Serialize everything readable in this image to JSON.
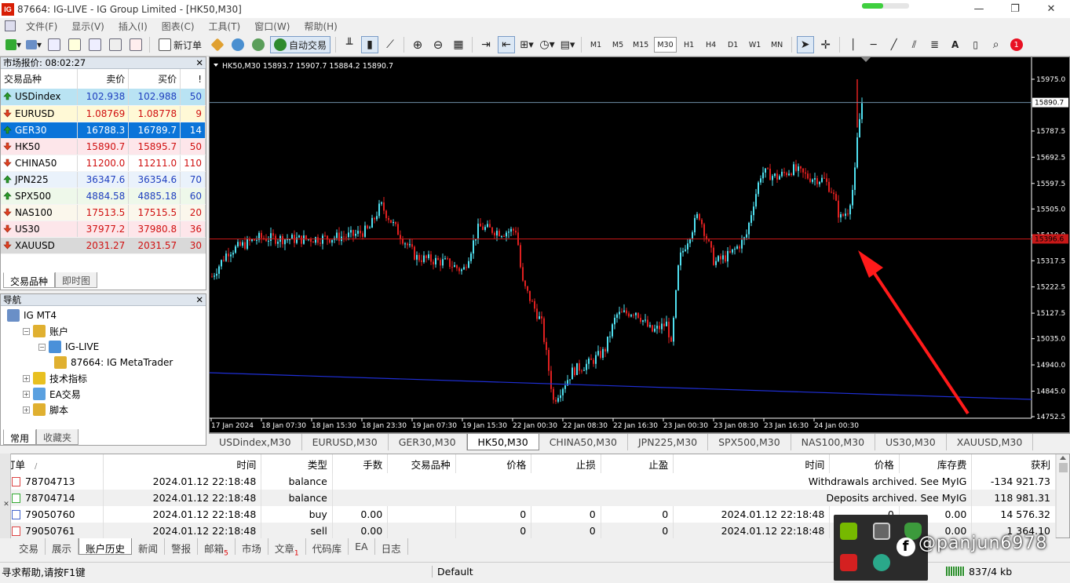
{
  "window": {
    "title": "87664: IG-LIVE - IG Group Limited - [HK50,M30]",
    "logo": "IG"
  },
  "menu": [
    "文件(F)",
    "显示(V)",
    "插入(I)",
    "图表(C)",
    "工具(T)",
    "窗口(W)",
    "帮助(H)"
  ],
  "toolbar": {
    "new_order": "新订单",
    "auto_trade": "自动交易",
    "notification_count": "1",
    "timeframes": [
      "M1",
      "M5",
      "M15",
      "M30",
      "H1",
      "H4",
      "D1",
      "W1",
      "MN"
    ],
    "active_timeframe": "M30"
  },
  "market_watch": {
    "title": "市场报价: 08:02:27",
    "headers": [
      "交易品种",
      "卖价",
      "买价",
      "!"
    ],
    "rows": [
      {
        "symbol": "USDindex",
        "bid": "102.938",
        "ask": "102.988",
        "spread": "50",
        "dir": "up",
        "bg": "#b9e3f3",
        "color": "#1f3fbf"
      },
      {
        "symbol": "EURUSD",
        "bid": "1.08769",
        "ask": "1.08778",
        "spread": "9",
        "dir": "down",
        "bg": "#fff9d6",
        "color": "#d01010"
      },
      {
        "symbol": "GER30",
        "bid": "16788.3",
        "ask": "16789.7",
        "spread": "14",
        "dir": "up",
        "bg": "#0a74d9",
        "color": "#ffffff"
      },
      {
        "symbol": "HK50",
        "bid": "15890.7",
        "ask": "15895.7",
        "spread": "50",
        "dir": "down",
        "bg": "#fde6ea",
        "color": "#d01010"
      },
      {
        "symbol": "CHINA50",
        "bid": "11200.0",
        "ask": "11211.0",
        "spread": "110",
        "dir": "down",
        "bg": "#ffffff",
        "color": "#d01010"
      },
      {
        "symbol": "JPN225",
        "bid": "36347.6",
        "ask": "36354.6",
        "spread": "70",
        "dir": "up",
        "bg": "#eaf2fb",
        "color": "#1f3fbf"
      },
      {
        "symbol": "SPX500",
        "bid": "4884.58",
        "ask": "4885.18",
        "spread": "60",
        "dir": "up",
        "bg": "#eef8ea",
        "color": "#1f3fbf"
      },
      {
        "symbol": "NAS100",
        "bid": "17513.5",
        "ask": "17515.5",
        "spread": "20",
        "dir": "down",
        "bg": "#fbf7ec",
        "color": "#d01010"
      },
      {
        "symbol": "US30",
        "bid": "37977.2",
        "ask": "37980.8",
        "spread": "36",
        "dir": "down",
        "bg": "#fde6ea",
        "color": "#d01010"
      },
      {
        "symbol": "XAUUSD",
        "bid": "2031.27",
        "ask": "2031.57",
        "spread": "30",
        "dir": "down",
        "bg": "#d9d9d9",
        "color": "#d01010"
      }
    ],
    "tabs": [
      "交易品种",
      "即时图"
    ]
  },
  "navigator": {
    "title": "导航",
    "items": [
      {
        "label": "IG MT4",
        "level": 0,
        "exp": "",
        "icon": "#6a8fc7"
      },
      {
        "label": "账户",
        "level": 1,
        "exp": "−",
        "icon": "#e0b030"
      },
      {
        "label": "IG-LIVE",
        "level": 2,
        "exp": "−",
        "icon": "#4a90d9"
      },
      {
        "label": "87664: IG MetaTrader",
        "level": 3,
        "exp": "",
        "icon": "#e0b030"
      },
      {
        "label": "技术指标",
        "level": 1,
        "exp": "+",
        "icon": "#e8c020"
      },
      {
        "label": "EA交易",
        "level": 1,
        "exp": "+",
        "icon": "#5aa0e0"
      },
      {
        "label": "脚本",
        "level": 1,
        "exp": "+",
        "icon": "#e0b030"
      }
    ],
    "tabs": [
      "常用",
      "收藏夹"
    ]
  },
  "chart": {
    "header": "HK50,M30  15893.7 15907.7 15884.2 15890.7",
    "current_price": "15890.7",
    "hline_label": "15396.6",
    "ticks": [
      "15975.0",
      "15787.5",
      "15692.5",
      "15597.5",
      "15505.0",
      "15410.0",
      "15317.5",
      "15222.5",
      "15127.5",
      "15035.0",
      "14940.0",
      "14845.0",
      "14752.5"
    ],
    "time_labels": [
      "17 Jan 2024",
      "18 Jan 07:30",
      "18 Jan 15:30",
      "18 Jan 23:30",
      "19 Jan 07:30",
      "19 Jan 15:30",
      "22 Jan 00:30",
      "22 Jan 08:30",
      "22 Jan 16:30",
      "23 Jan 00:30",
      "23 Jan 08:30",
      "23 Jan 16:30",
      "24 Jan 00:30"
    ],
    "bull_color": "#50e0f0",
    "bear_color": "#e02020",
    "grid": false
  },
  "chart_tabs": [
    "USDindex,M30",
    "EURUSD,M30",
    "GER30,M30",
    "HK50,M30",
    "CHINA50,M30",
    "JPN225,M30",
    "SPX500,M30",
    "NAS100,M30",
    "US30,M30",
    "XAUUSD,M30"
  ],
  "active_chart_tab": "HK50,M30",
  "terminal": {
    "headers": [
      "订单",
      "时间",
      "类型",
      "手数",
      "交易品种",
      "价格",
      "止损",
      "止盈",
      "时间",
      "价格",
      "库存费",
      "获利"
    ],
    "rows": [
      {
        "order": "78704713",
        "time": "2024.01.12 22:18:48",
        "type": "balance",
        "comment": "Withdrawals archived. See MyIG",
        "swap": "",
        "profit": "-134 921.73",
        "icon": "#d44"
      },
      {
        "order": "78704714",
        "time": "2024.01.12 22:18:48",
        "type": "balance",
        "comment": "Deposits archived. See MyIG",
        "swap": "",
        "profit": "118 981.31",
        "icon": "#3a3"
      },
      {
        "order": "79050760",
        "time": "2024.01.12 22:18:48",
        "type": "buy",
        "lots": "0.00",
        "symbol": "",
        "price": "0",
        "sl": "0",
        "tp": "0",
        "ctime": "2024.01.12 22:18:48",
        "cprice": "0",
        "swap": "0.00",
        "profit": "14 576.32",
        "icon": "#46c"
      },
      {
        "order": "79050761",
        "time": "2024.01.12 22:18:48",
        "type": "sell",
        "lots": "0.00",
        "symbol": "",
        "price": "0",
        "sl": "0",
        "tp": "0",
        "ctime": "2024.01.12 22:18:48",
        "cprice": "0",
        "swap": "0.00",
        "profit": "1 364.10",
        "icon": "#d44"
      }
    ],
    "tabs": [
      {
        "label": "交易"
      },
      {
        "label": "展示"
      },
      {
        "label": "账户历史",
        "active": true
      },
      {
        "label": "新闻"
      },
      {
        "label": "警报"
      },
      {
        "label": "邮箱",
        "sub": "5"
      },
      {
        "label": "市场"
      },
      {
        "label": "文章",
        "sub": "1"
      },
      {
        "label": "代码库"
      },
      {
        "label": "EA"
      },
      {
        "label": "日志"
      }
    ]
  },
  "status": {
    "help": "寻求帮助,请按F1键",
    "profile": "Default",
    "traffic": "837/4 kb"
  },
  "watermark": "@panjun6978"
}
